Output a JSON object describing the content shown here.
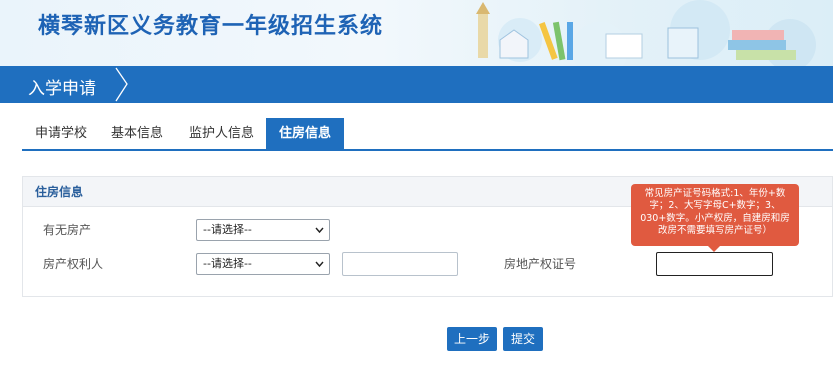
{
  "header": {
    "title": "横琴新区义务教育一年级招生系统"
  },
  "nav": {
    "section_title": "入学申请"
  },
  "tabs": [
    {
      "label": "申请学校",
      "active": false
    },
    {
      "label": "基本信息",
      "active": false
    },
    {
      "label": "监护人信息",
      "active": false
    },
    {
      "label": "住房信息",
      "active": true
    }
  ],
  "panel": {
    "title": "住房信息",
    "fields": {
      "has_property_label": "有无房产",
      "has_property_value": "--请选择--",
      "owner_label": "房产权利人",
      "owner_value": "--请选择--",
      "cert_no_label": "房地产权证号"
    }
  },
  "tooltip": {
    "text": "常见房产证号码格式:1、年份+数字；2、大写字母C+数字；3、030+数字。小产权房，自建房和房改房不需要填写房产证号）"
  },
  "buttons": {
    "prev": "上一步",
    "submit": "提交"
  },
  "colors": {
    "primary": "#1f6fbf",
    "title": "#1e63b5",
    "tooltip": "#e05a40"
  }
}
